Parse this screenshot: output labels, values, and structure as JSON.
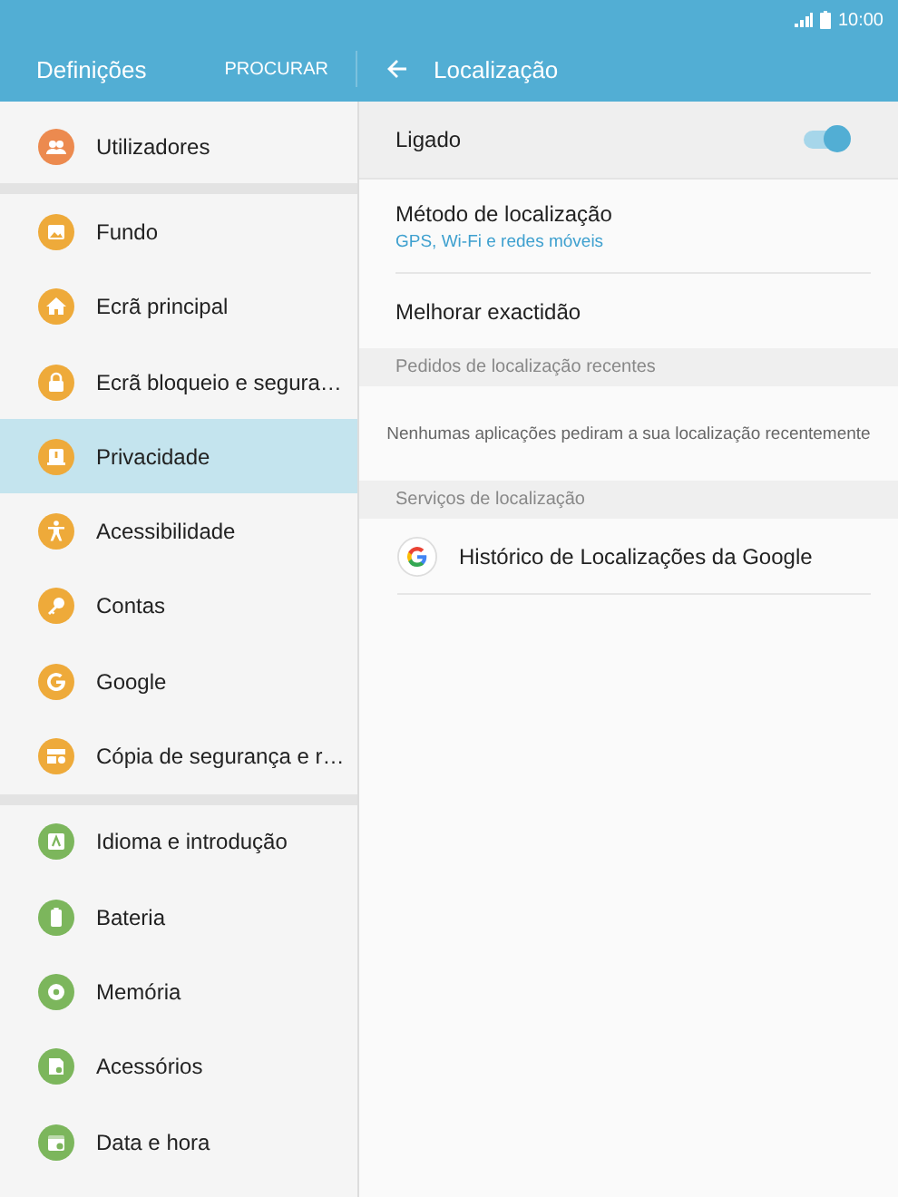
{
  "status_bar": {
    "time": "10:00"
  },
  "header": {
    "title": "Definições",
    "search": "PROCURAR",
    "detail_title": "Localização"
  },
  "sidebar": {
    "groups": [
      {
        "items": [
          {
            "label": "Utilizadores",
            "color": "#ec8a4f",
            "selected": false
          }
        ]
      },
      {
        "items": [
          {
            "label": "Fundo",
            "color": "#eeaa3a",
            "selected": false
          },
          {
            "label": "Ecrã principal",
            "color": "#eeaa3a",
            "selected": false
          },
          {
            "label": "Ecrã bloqueio e segura…",
            "color": "#eeaa3a",
            "selected": false
          },
          {
            "label": "Privacidade",
            "color": "#eeaa3a",
            "selected": true
          },
          {
            "label": "Acessibilidade",
            "color": "#eeaa3a",
            "selected": false
          },
          {
            "label": "Contas",
            "color": "#eeaa3a",
            "selected": false
          },
          {
            "label": "Google",
            "color": "#eeaa3a",
            "selected": false
          },
          {
            "label": "Cópia de segurança e r…",
            "color": "#eeaa3a",
            "selected": false
          }
        ]
      },
      {
        "items": [
          {
            "label": "Idioma e introdução",
            "color": "#7cb65c",
            "selected": false
          },
          {
            "label": "Bateria",
            "color": "#7cb65c",
            "selected": false
          },
          {
            "label": "Memória",
            "color": "#7cb65c",
            "selected": false
          },
          {
            "label": "Acessórios",
            "color": "#7cb65c",
            "selected": false
          },
          {
            "label": "Data e hora",
            "color": "#7cb65c",
            "selected": false
          }
        ]
      }
    ]
  },
  "detail": {
    "rows": [
      {
        "kind": "toggle",
        "label": "Ligado",
        "on": true
      },
      {
        "kind": "setting",
        "label": "Método de localização",
        "subtitle": "GPS, Wi-Fi e redes móveis"
      },
      {
        "kind": "setting",
        "label": "Melhorar exactidão"
      },
      {
        "kind": "section",
        "label": "Pedidos de localização recentes"
      },
      {
        "kind": "message",
        "label": "Nenhumas aplicações pediram a sua localização recentemente"
      },
      {
        "kind": "section",
        "label": "Serviços de localização"
      },
      {
        "kind": "app",
        "label": "Histórico de Localizações da Google"
      }
    ]
  }
}
